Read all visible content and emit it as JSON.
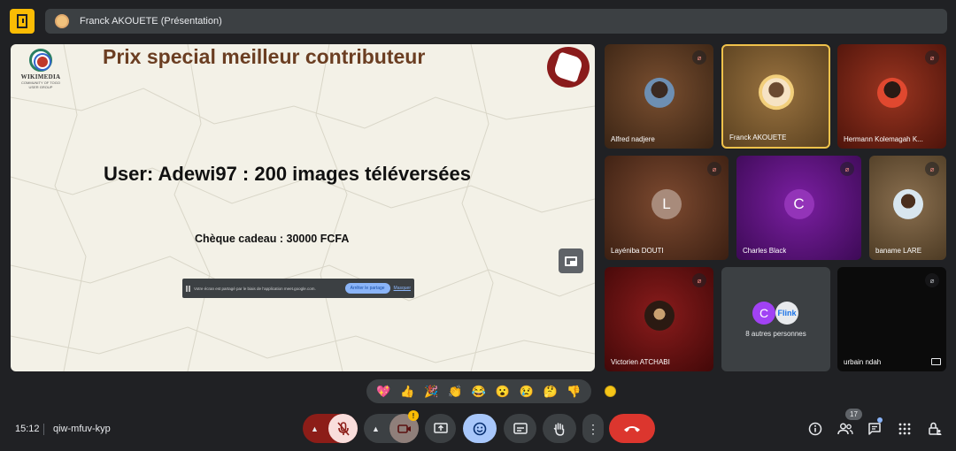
{
  "header": {
    "presenter_label": "Franck AKOUETE (Présentation)",
    "colors": {
      "accent": "#fbbc04",
      "bar": "#3c4043"
    }
  },
  "slide": {
    "title": "Prix special meilleur contributeur",
    "logo_name": "WIKIMEDIA",
    "logo_sub_1": "COMMUNITY OF TOGO",
    "logo_sub_2": "USER GROUP",
    "main_text": "User: Adewi97 : 200 images téléversées",
    "sub_text": "Chèque cadeau : 30000 FCFA",
    "share_bar": {
      "message": "Votre écran est partagé par le biais de l'application meet.google.com.",
      "stop_label": "Arrêter le partage",
      "hide_label": "Masquer"
    }
  },
  "participants": [
    {
      "name": "Alfred nadjere",
      "muted": true,
      "avatar": "photo"
    },
    {
      "name": "Franck AKOUETE",
      "muted": false,
      "speaking": true,
      "avatar": "photo"
    },
    {
      "name": "Hermann Kolemagah K...",
      "muted": true,
      "avatar": "photo"
    },
    {
      "name": "Layéniba DOUTI",
      "muted": true,
      "avatar": "initial",
      "initial": "L"
    },
    {
      "name": "Charles Black",
      "muted": true,
      "avatar": "initial",
      "initial": "C"
    },
    {
      "name": "baname LARE",
      "muted": true,
      "avatar": "photo"
    },
    {
      "name": "Victorien ATCHABI",
      "muted": true,
      "avatar": "photo"
    },
    {
      "name": "8 autres personnes",
      "initial": "C",
      "second_avatar": "Flink"
    },
    {
      "name": "urbain ndah",
      "muted": true,
      "avatar": "none"
    }
  ],
  "reactions": [
    "💖",
    "👍",
    "🎉",
    "👏",
    "😂",
    "😮",
    "😢",
    "🤔",
    "👎"
  ],
  "footer": {
    "time": "15:12",
    "meeting_code": "qiw-mfuv-kyp",
    "camera_warning": "!",
    "participant_count": "17"
  }
}
